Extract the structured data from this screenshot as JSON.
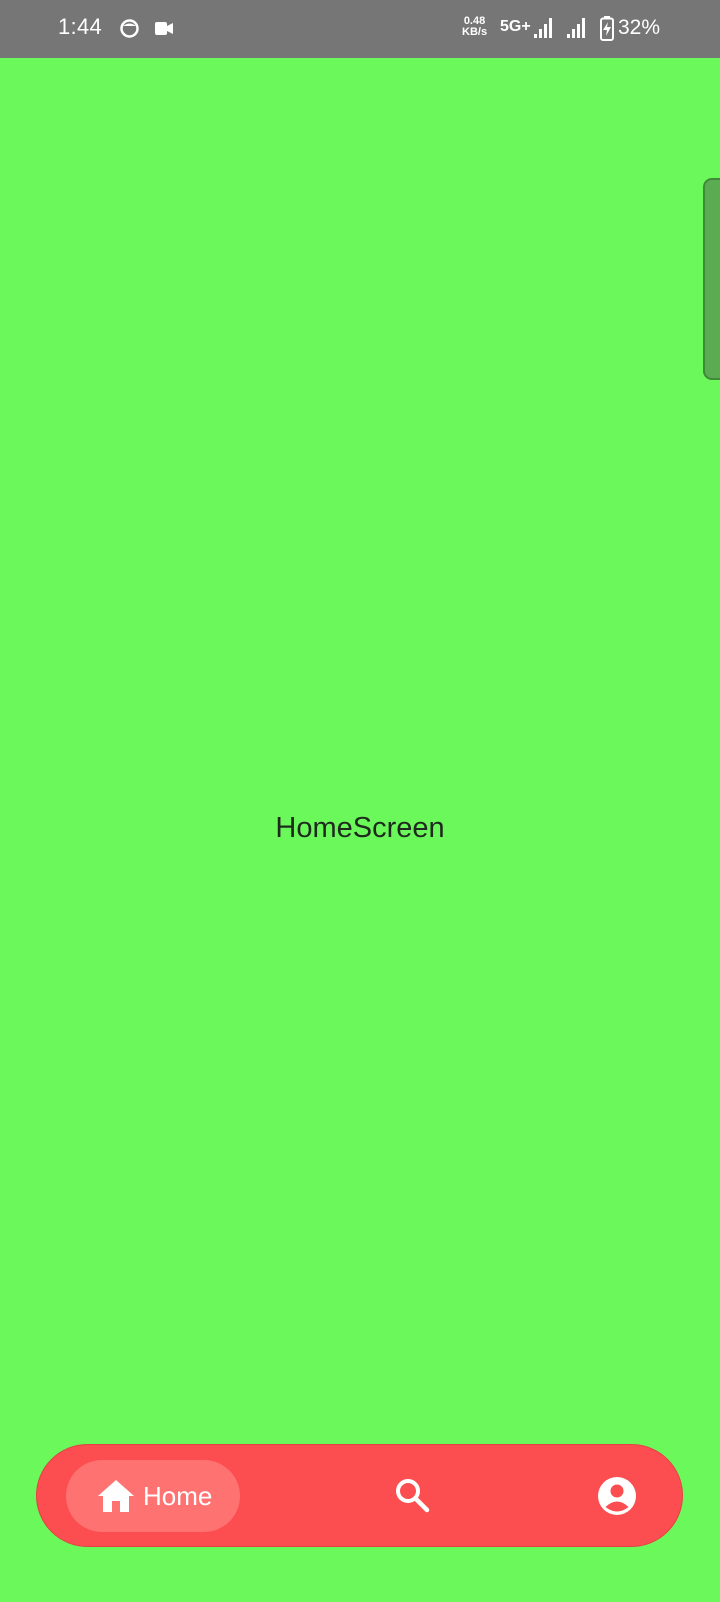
{
  "status_bar": {
    "time": "1:44",
    "net_speed_value": "0.48",
    "net_speed_unit": "KB/s",
    "network_type": "5G+",
    "battery": "32%",
    "icons": [
      "face-icon",
      "video-camera-icon",
      "signal-icon",
      "signal-icon",
      "battery-charging-icon"
    ]
  },
  "screen": {
    "title": "HomeScreen"
  },
  "bottom_nav": {
    "home_label": "Home",
    "items": [
      {
        "icon": "home-icon",
        "label": "Home",
        "selected": true
      },
      {
        "icon": "search-icon",
        "selected": false
      },
      {
        "icon": "account-circle-icon",
        "selected": false
      }
    ]
  },
  "colors": {
    "background": "#6bf85a",
    "status_bar": "#767676",
    "nav_bar": "#fc4e50",
    "nav_selected": "#ff7272",
    "side_handle": "#5aab52"
  }
}
